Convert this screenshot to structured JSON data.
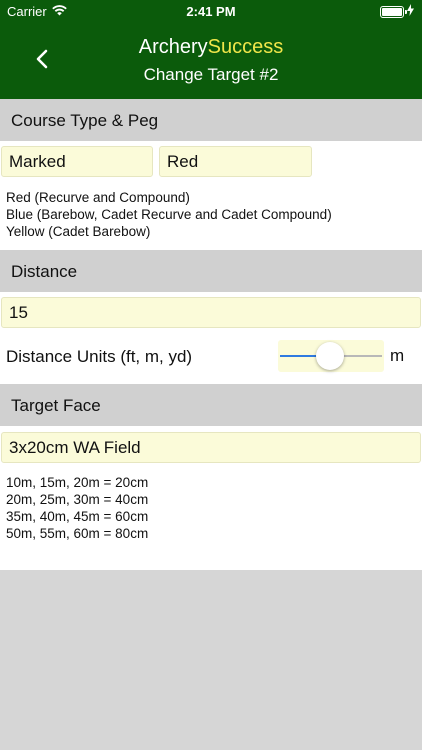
{
  "status_bar": {
    "carrier": "Carrier",
    "time": "2:41 PM"
  },
  "header": {
    "title_part1": "Archery",
    "title_part2": "Success",
    "subtitle": "Change Target #2",
    "accent_color": "#f0e64a",
    "background": "#0b5b0b"
  },
  "course": {
    "section_title": "Course Type & Peg",
    "course_type": "Marked",
    "peg": "Red",
    "notes": [
      "Red (Recurve and Compound)",
      "Blue (Barebow, Cadet Recurve and Cadet Compound)",
      "Yellow (Cadet Barebow)"
    ]
  },
  "distance": {
    "section_title": "Distance",
    "value": "15",
    "units_label": "Distance Units (ft, m, yd)",
    "unit": "m",
    "slider_position": "middle"
  },
  "target_face": {
    "section_title": "Target Face",
    "value": "3x20cm WA Field",
    "notes": [
      "10m, 15m, 20m = 20cm",
      "20m, 25m, 30m = 40cm",
      "35m, 40m, 45m = 60cm",
      "50m, 55m, 60m = 80cm"
    ]
  }
}
